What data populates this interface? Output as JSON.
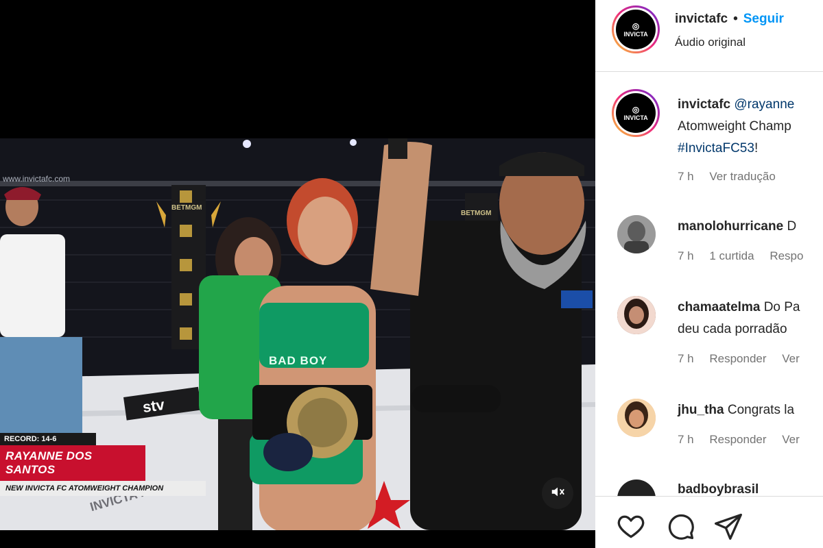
{
  "video": {
    "watermark": "www.invictafc.com",
    "arena_logo": "BETMGM",
    "shorts_text": "BAD BOY",
    "mat_logo": "stv",
    "mat_text": "INVICTA FC",
    "lower_third": {
      "record": "RECORD: 14-6",
      "name": "RAYANNE DOS SANTOS",
      "title": "NEW INVICTA FC ATOMWEIGHT CHAMPION"
    },
    "mute_icon": "speaker-muted-icon"
  },
  "header": {
    "username": "invictafc",
    "separator": "•",
    "follow_label": "Seguir",
    "audio_label": "Áudio original",
    "logo_text": "INVICTA"
  },
  "caption": {
    "username": "invictafc",
    "mention": "@rayanne",
    "line2": "Atomweight Champ",
    "hashtag": "#InvictaFC53",
    "line3_suffix": "!",
    "time": "7 h",
    "translate_label": "Ver tradução"
  },
  "comments": [
    {
      "username": "manolohurricane",
      "text": "D",
      "time": "7 h",
      "likes": "1 curtida",
      "reply": "Respo",
      "more": ""
    },
    {
      "username": "chamaatelma",
      "text": "Do Pa",
      "text2": "deu cada porradão",
      "time": "7 h",
      "reply": "Responder",
      "more": "Ver"
    },
    {
      "username": "jhu_tha",
      "text": "Congrats la",
      "time": "7 h",
      "reply": "Responder",
      "more": "Ver"
    },
    {
      "username": "badboybrasil",
      "text": ""
    }
  ],
  "actions": {
    "like_icon": "heart-icon",
    "comment_icon": "comment-icon",
    "share_icon": "send-icon"
  },
  "colors": {
    "accent": "#0095f6",
    "lower_third_red": "#c8102e",
    "jersey_green": "#0f9a63"
  }
}
